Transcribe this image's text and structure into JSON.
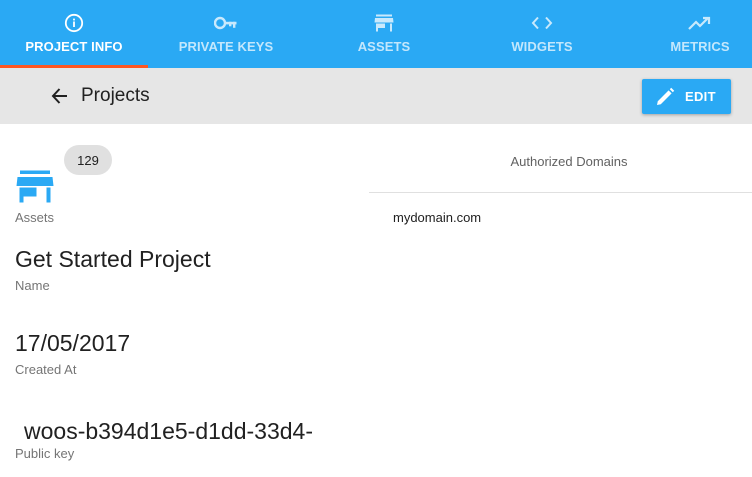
{
  "tabs": [
    {
      "label": "PROJECT INFO",
      "icon": "info-icon",
      "active": true
    },
    {
      "label": "PRIVATE KEYS",
      "icon": "key-icon",
      "active": false
    },
    {
      "label": "ASSETS",
      "icon": "store-icon",
      "active": false
    },
    {
      "label": "WIDGETS",
      "icon": "code-icon",
      "active": false
    },
    {
      "label": "METRICS",
      "icon": "trending-up-icon",
      "active": false
    }
  ],
  "toolbar": {
    "back_icon": "arrow-left-icon",
    "title": "Projects",
    "edit_label": "EDIT",
    "edit_icon": "pencil-icon"
  },
  "project": {
    "assets_count": "129",
    "assets_icon": "store-icon",
    "assets_label": "Assets",
    "name": "Get Started Project",
    "name_label": "Name",
    "created_at": "17/05/2017",
    "created_at_label": "Created At",
    "public_key": "woos-b394d1e5-d1dd-33d4-",
    "public_key_label": "Public key"
  },
  "domains": {
    "header": "Authorized Domains",
    "items": [
      "mydomain.com"
    ]
  },
  "colors": {
    "primary": "#2aa9f4",
    "tab_indicator": "#ff5722",
    "toolbar_bg": "#e6e6e6",
    "badge_bg": "#e0e0e0"
  }
}
